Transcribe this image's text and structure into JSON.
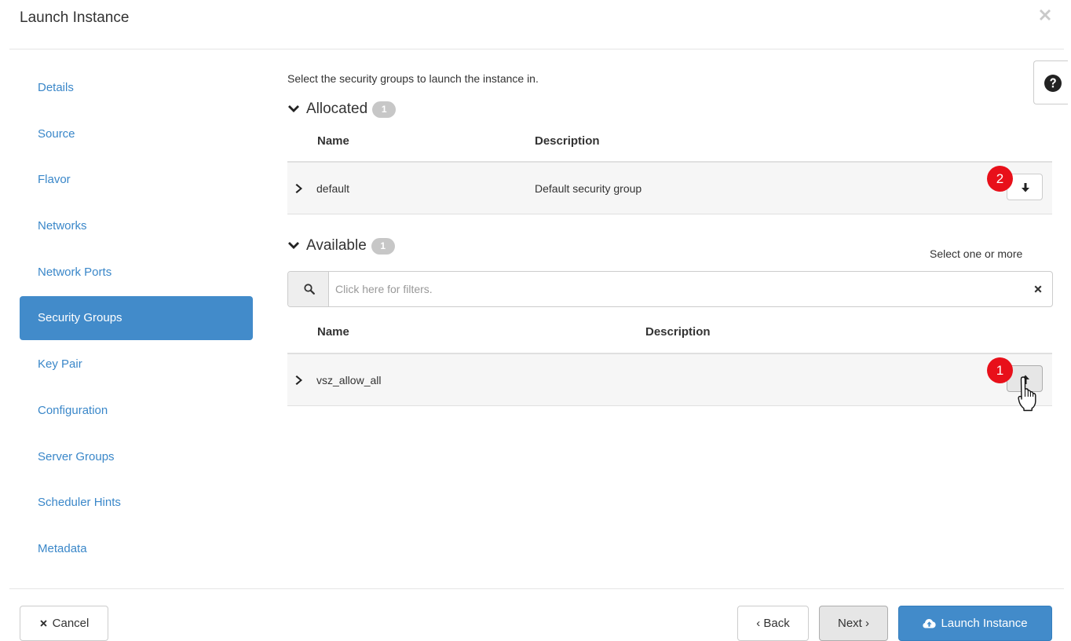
{
  "dialog": {
    "title": "Launch Instance"
  },
  "nav": {
    "items": [
      {
        "label": "Details",
        "active": false
      },
      {
        "label": "Source",
        "active": false
      },
      {
        "label": "Flavor",
        "active": false
      },
      {
        "label": "Networks",
        "active": false
      },
      {
        "label": "Network Ports",
        "active": false
      },
      {
        "label": "Security Groups",
        "active": true
      },
      {
        "label": "Key Pair",
        "active": false
      },
      {
        "label": "Configuration",
        "active": false
      },
      {
        "label": "Server Groups",
        "active": false
      },
      {
        "label": "Scheduler Hints",
        "active": false
      },
      {
        "label": "Metadata",
        "active": false
      }
    ]
  },
  "main": {
    "intro": "Select the security groups to launch the instance in.",
    "allocated": {
      "heading": "Allocated",
      "count": "1",
      "columns": {
        "name": "Name",
        "description": "Description"
      },
      "rows": [
        {
          "name": "default",
          "description": "Default security group"
        }
      ]
    },
    "available": {
      "heading": "Available",
      "count": "1",
      "hint": "Select one or more",
      "search_placeholder": "Click here for filters.",
      "columns": {
        "name": "Name",
        "description": "Description"
      },
      "rows": [
        {
          "name": "vsz_allow_all",
          "description": ""
        }
      ]
    },
    "annotations": {
      "step1": "1",
      "step2": "2"
    }
  },
  "footer": {
    "cancel": "Cancel",
    "back": "‹ Back",
    "next": "Next ›",
    "launch": "Launch Instance"
  },
  "icons": {
    "close": "close-icon",
    "help": "question-circle-icon",
    "search": "search-icon",
    "clear": "times-icon",
    "up": "arrow-up-icon",
    "down": "arrow-down-icon",
    "cloud": "cloud-upload-icon"
  },
  "colors": {
    "primary": "#428bca",
    "link": "#3a87c9",
    "badge_red": "#e8101a",
    "count_badge": "#c7c7c7"
  }
}
